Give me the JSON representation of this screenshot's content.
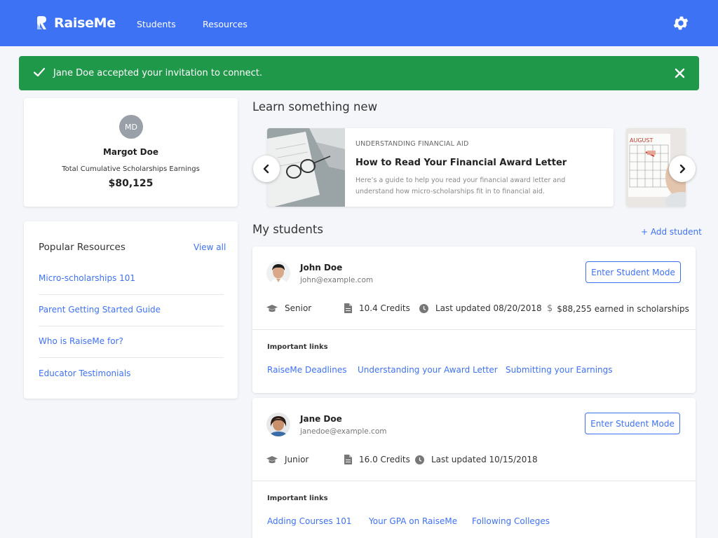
{
  "header": {
    "brand": "RaiseMe",
    "nav": [
      {
        "label": "Students"
      },
      {
        "label": "Resources"
      }
    ],
    "bg_color": "#3e72f5",
    "settings_icon": "gear-icon"
  },
  "alert": {
    "message": "Jane Doe accepted your invitation to connect.",
    "bg_color": "#1f9849",
    "icon": "check-icon",
    "close_icon": "close-icon"
  },
  "profile": {
    "initials": "MD",
    "name": "Margot Doe",
    "earnings_label": "Total Cumulative Scholarships Earnings",
    "earnings_amount": "$80,125"
  },
  "popular_resources": {
    "title": "Popular Resources",
    "view_all": "View all",
    "items": [
      {
        "label": "Micro-scholarships 101"
      },
      {
        "label": "Parent Getting Started Guide"
      },
      {
        "label": "Who is RaiseMe for?"
      },
      {
        "label": "Educator Testimonials"
      }
    ]
  },
  "learn": {
    "title": "Learn something new",
    "articles": [
      {
        "category": "UNDERSTANDING FINANCIAL AID",
        "title": "How to Read Your Financial Award Letter",
        "description": "Here’s a guide to help you read your financial award letter and understand how micro-scholarships fit in to financial aid."
      },
      {
        "calendar_month": "AUGUST"
      }
    ]
  },
  "students": {
    "title": "My students",
    "add_label": "+ Add student",
    "items": [
      {
        "name": "John Doe",
        "email": "john@example.com",
        "button": "Enter Student Mode",
        "grade": "Senior",
        "credits": "10.4 Credits",
        "updated": "Last updated 08/20/2018",
        "earned": "$88,255 earned in scholarships",
        "links_label": "Important links",
        "links": [
          "RaiseMe Deadlines",
          "Understanding your Award Letter",
          "Submitting your Earnings"
        ]
      },
      {
        "name": "Jane Doe",
        "email": "janedoe@example.com",
        "button": "Enter Student Mode",
        "grade": "Junior",
        "credits": "16.0 Credits",
        "updated": "Last updated 10/15/2018",
        "links_label": "Important links",
        "links": [
          "Adding Courses 101",
          "Your GPA on RaiseMe",
          "Following Colleges"
        ]
      }
    ]
  },
  "colors": {
    "accent": "#3e72f5",
    "success": "#1f9849",
    "page_bg": "#f4f6f9"
  }
}
